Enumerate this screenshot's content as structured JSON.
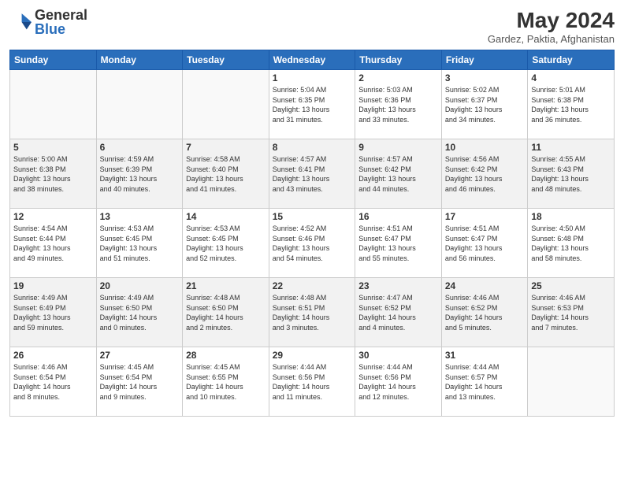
{
  "logo": {
    "general": "General",
    "blue": "Blue"
  },
  "header": {
    "month_year": "May 2024",
    "location": "Gardez, Paktia, Afghanistan"
  },
  "weekdays": [
    "Sunday",
    "Monday",
    "Tuesday",
    "Wednesday",
    "Thursday",
    "Friday",
    "Saturday"
  ],
  "weeks": [
    [
      {
        "day": "",
        "info": ""
      },
      {
        "day": "",
        "info": ""
      },
      {
        "day": "",
        "info": ""
      },
      {
        "day": "1",
        "info": "Sunrise: 5:04 AM\nSunset: 6:35 PM\nDaylight: 13 hours\nand 31 minutes."
      },
      {
        "day": "2",
        "info": "Sunrise: 5:03 AM\nSunset: 6:36 PM\nDaylight: 13 hours\nand 33 minutes."
      },
      {
        "day": "3",
        "info": "Sunrise: 5:02 AM\nSunset: 6:37 PM\nDaylight: 13 hours\nand 34 minutes."
      },
      {
        "day": "4",
        "info": "Sunrise: 5:01 AM\nSunset: 6:38 PM\nDaylight: 13 hours\nand 36 minutes."
      }
    ],
    [
      {
        "day": "5",
        "info": "Sunrise: 5:00 AM\nSunset: 6:38 PM\nDaylight: 13 hours\nand 38 minutes."
      },
      {
        "day": "6",
        "info": "Sunrise: 4:59 AM\nSunset: 6:39 PM\nDaylight: 13 hours\nand 40 minutes."
      },
      {
        "day": "7",
        "info": "Sunrise: 4:58 AM\nSunset: 6:40 PM\nDaylight: 13 hours\nand 41 minutes."
      },
      {
        "day": "8",
        "info": "Sunrise: 4:57 AM\nSunset: 6:41 PM\nDaylight: 13 hours\nand 43 minutes."
      },
      {
        "day": "9",
        "info": "Sunrise: 4:57 AM\nSunset: 6:42 PM\nDaylight: 13 hours\nand 44 minutes."
      },
      {
        "day": "10",
        "info": "Sunrise: 4:56 AM\nSunset: 6:42 PM\nDaylight: 13 hours\nand 46 minutes."
      },
      {
        "day": "11",
        "info": "Sunrise: 4:55 AM\nSunset: 6:43 PM\nDaylight: 13 hours\nand 48 minutes."
      }
    ],
    [
      {
        "day": "12",
        "info": "Sunrise: 4:54 AM\nSunset: 6:44 PM\nDaylight: 13 hours\nand 49 minutes."
      },
      {
        "day": "13",
        "info": "Sunrise: 4:53 AM\nSunset: 6:45 PM\nDaylight: 13 hours\nand 51 minutes."
      },
      {
        "day": "14",
        "info": "Sunrise: 4:53 AM\nSunset: 6:45 PM\nDaylight: 13 hours\nand 52 minutes."
      },
      {
        "day": "15",
        "info": "Sunrise: 4:52 AM\nSunset: 6:46 PM\nDaylight: 13 hours\nand 54 minutes."
      },
      {
        "day": "16",
        "info": "Sunrise: 4:51 AM\nSunset: 6:47 PM\nDaylight: 13 hours\nand 55 minutes."
      },
      {
        "day": "17",
        "info": "Sunrise: 4:51 AM\nSunset: 6:47 PM\nDaylight: 13 hours\nand 56 minutes."
      },
      {
        "day": "18",
        "info": "Sunrise: 4:50 AM\nSunset: 6:48 PM\nDaylight: 13 hours\nand 58 minutes."
      }
    ],
    [
      {
        "day": "19",
        "info": "Sunrise: 4:49 AM\nSunset: 6:49 PM\nDaylight: 13 hours\nand 59 minutes."
      },
      {
        "day": "20",
        "info": "Sunrise: 4:49 AM\nSunset: 6:50 PM\nDaylight: 14 hours\nand 0 minutes."
      },
      {
        "day": "21",
        "info": "Sunrise: 4:48 AM\nSunset: 6:50 PM\nDaylight: 14 hours\nand 2 minutes."
      },
      {
        "day": "22",
        "info": "Sunrise: 4:48 AM\nSunset: 6:51 PM\nDaylight: 14 hours\nand 3 minutes."
      },
      {
        "day": "23",
        "info": "Sunrise: 4:47 AM\nSunset: 6:52 PM\nDaylight: 14 hours\nand 4 minutes."
      },
      {
        "day": "24",
        "info": "Sunrise: 4:46 AM\nSunset: 6:52 PM\nDaylight: 14 hours\nand 5 minutes."
      },
      {
        "day": "25",
        "info": "Sunrise: 4:46 AM\nSunset: 6:53 PM\nDaylight: 14 hours\nand 7 minutes."
      }
    ],
    [
      {
        "day": "26",
        "info": "Sunrise: 4:46 AM\nSunset: 6:54 PM\nDaylight: 14 hours\nand 8 minutes."
      },
      {
        "day": "27",
        "info": "Sunrise: 4:45 AM\nSunset: 6:54 PM\nDaylight: 14 hours\nand 9 minutes."
      },
      {
        "day": "28",
        "info": "Sunrise: 4:45 AM\nSunset: 6:55 PM\nDaylight: 14 hours\nand 10 minutes."
      },
      {
        "day": "29",
        "info": "Sunrise: 4:44 AM\nSunset: 6:56 PM\nDaylight: 14 hours\nand 11 minutes."
      },
      {
        "day": "30",
        "info": "Sunrise: 4:44 AM\nSunset: 6:56 PM\nDaylight: 14 hours\nand 12 minutes."
      },
      {
        "day": "31",
        "info": "Sunrise: 4:44 AM\nSunset: 6:57 PM\nDaylight: 14 hours\nand 13 minutes."
      },
      {
        "day": "",
        "info": ""
      }
    ]
  ]
}
